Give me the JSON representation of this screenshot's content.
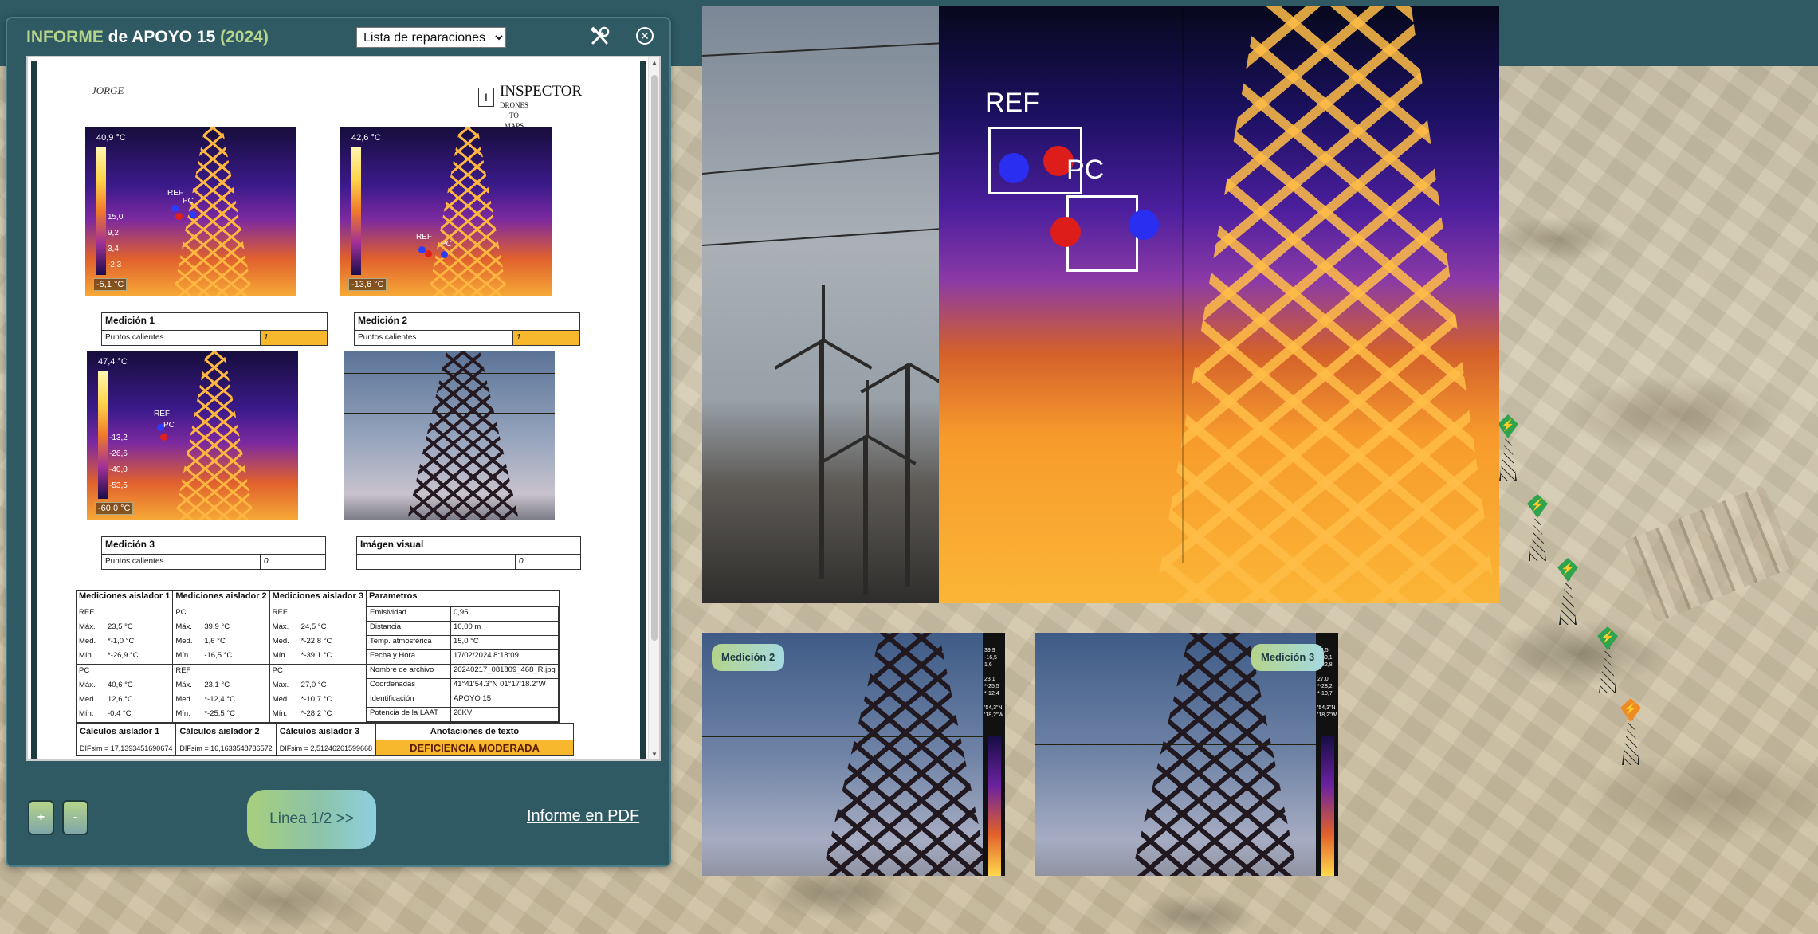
{
  "panel": {
    "title_part1": "INFORME",
    "title_part2": " de APOYO 15 ",
    "title_part3": "(2024)",
    "select_value": "Lista de reparaciones",
    "close_symbol": "✕",
    "zoom_in_label": "+",
    "zoom_out_label": "-",
    "line_button_label": "Linea 1/2 >>",
    "pdf_link_label": "Informe en PDF"
  },
  "report": {
    "logo_left": "JORGE",
    "logo_right_letter": "I",
    "logo_right_main": "INSPECTOR",
    "logo_right_sub": "DRONES TO MAPS",
    "thermal1": {
      "tmax": "40,9 °C",
      "tmin": "-5,1 °C",
      "ticks": [
        "15,0",
        "9,2",
        "3,4",
        "-2,3"
      ],
      "ref": "REF",
      "pc": "PC"
    },
    "thermal2": {
      "tmax": "42,6 °C",
      "tmin": "-13,6 °C",
      "ref": "REF",
      "pc": "PC"
    },
    "thermal3": {
      "tmax": "47,4 °C",
      "tmin": "-60,0 °C",
      "ticks": [
        "-13,2",
        "-26,6",
        "-40,0",
        "-53,5"
      ],
      "ref": "REF",
      "pc": "PC"
    },
    "measures": [
      {
        "title": "Medición 1",
        "label": "Puntos calientes",
        "value": "1",
        "hot": true
      },
      {
        "title": "Medición 2",
        "label": "Puntos calientes",
        "value": "1",
        "hot": true
      },
      {
        "title": "Medición 3",
        "label": "Puntos calientes",
        "value": "0",
        "hot": false
      },
      {
        "title": "Imágen visual",
        "label": "",
        "value": "0",
        "hot": false
      }
    ],
    "table_headers": [
      "Mediciones aislador 1",
      "Mediciones aislador 2",
      "Mediciones aislador 3",
      "Parametros"
    ],
    "stat_labels": [
      "Máx.",
      "Med.",
      "Mín."
    ],
    "aislador1": {
      "g1": "REF",
      "g1v": [
        "23,5 °C",
        "*-1,0 °C",
        "*-26,9 °C"
      ],
      "g2": "PC",
      "g2v": [
        "40,6 °C",
        "12,6 °C",
        "-0,4 °C"
      ]
    },
    "aislador2": {
      "g1": "PC",
      "g1v": [
        "39,9 °C",
        "1,6 °C",
        "-16,5 °C"
      ],
      "g2": "REF",
      "g2v": [
        "23,1 °C",
        "*-12,4 °C",
        "*-25,5 °C"
      ]
    },
    "aislador3": {
      "g1": "REF",
      "g1v": [
        "24,5 °C",
        "*-22,8 °C",
        "*-39,1 °C"
      ],
      "g2": "PC",
      "g2v": [
        "27,0 °C",
        "*-10,7 °C",
        "*-28,2 °C"
      ]
    },
    "parametros": [
      {
        "k": "Emisividad",
        "v": "0,95"
      },
      {
        "k": "Distancia",
        "v": "10,00 m"
      },
      {
        "k": "Temp. atmosférica",
        "v": "15,0 °C"
      },
      {
        "k": "Fecha y Hora",
        "v": "17/02/2024 8:18:09"
      },
      {
        "k": "Nombre de archivo",
        "v": "20240217_081809_468_R.jpg"
      },
      {
        "k": "Coordenadas",
        "v": "41°41'54.3\"N 01°17'18.2\"W"
      },
      {
        "k": "Identificación",
        "v": "APOYO 15"
      },
      {
        "k": "Potencia de la LAAT",
        "v": "20KV"
      }
    ],
    "calc_headers": [
      "Cálculos aislador 1",
      "Cálculos aislador 2",
      "Cálculos aislador 3",
      "Anotaciones de texto"
    ],
    "calc_values": [
      "DIFsim = 17,1393451690674",
      "DIFsim = 16,1633548736572",
      "DIFsim = 2,51246261599668"
    ],
    "annotation": "DEFICIENCIA MODERADA"
  },
  "viewer": {
    "ref_label": "REF",
    "pc_label": "PC"
  },
  "thumbs": [
    {
      "label": "Medición 2",
      "scale": "39,9\n-16,5\n1,6\n\n23,1\n*-25,5\n*-12,4\n\n'54,3\"N\n'18,2\"W"
    },
    {
      "label": "Medición 3",
      "scale": "24,5\n*-39,1\n*-22,8\n\n27,0\n*-28,2\n*-10,7\n\n'54,3\"N\n'18,2\"W"
    }
  ]
}
